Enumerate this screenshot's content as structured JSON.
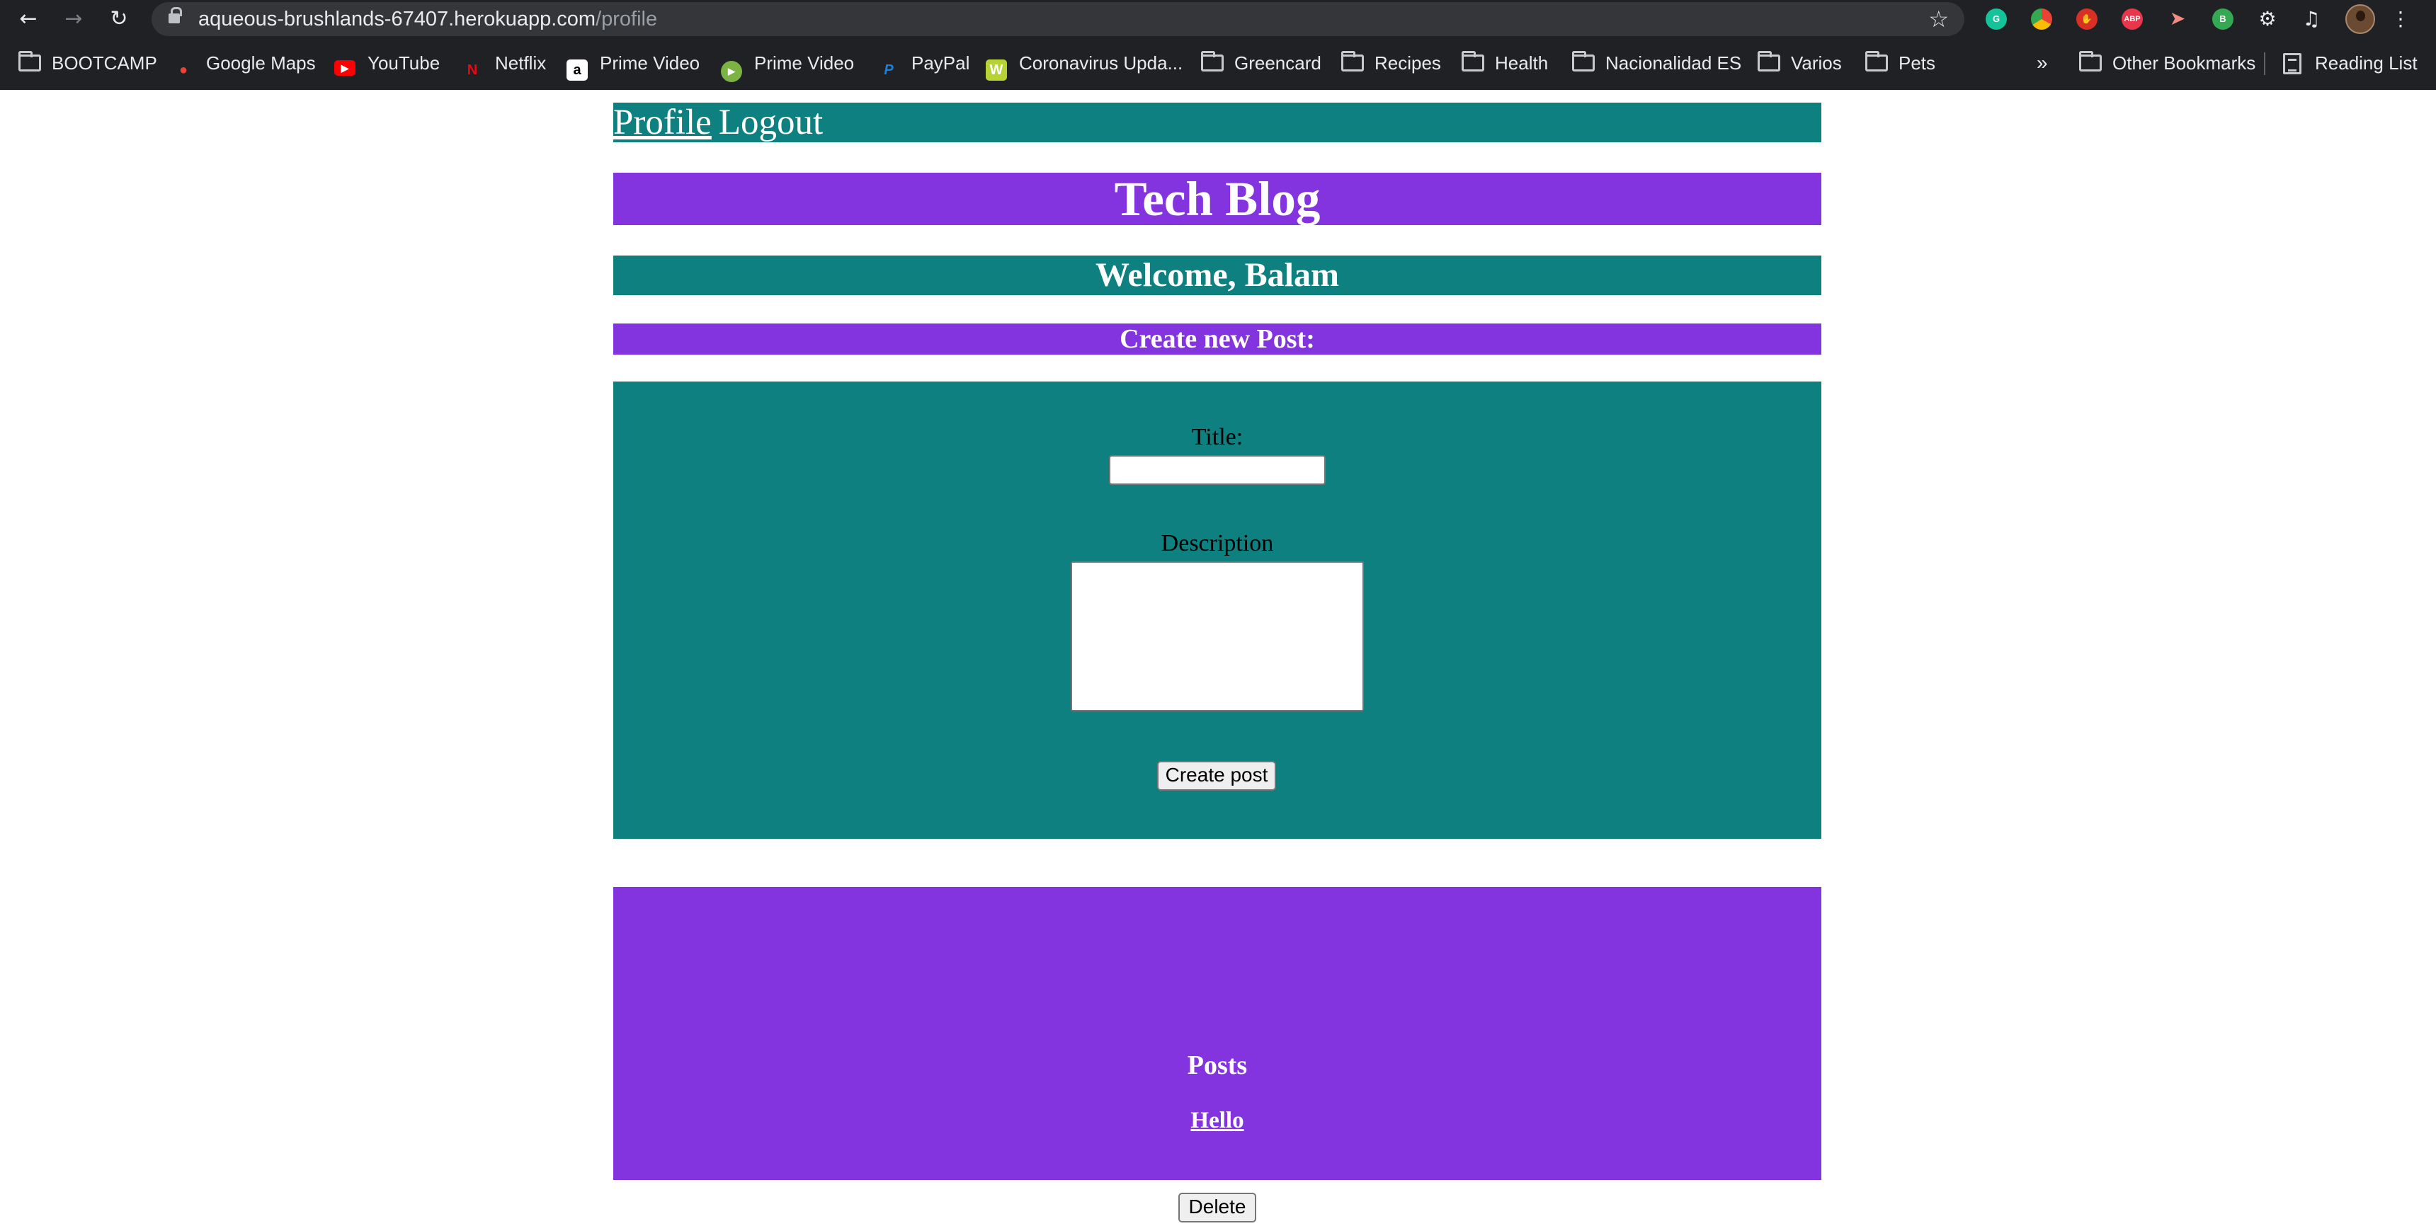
{
  "browser": {
    "url_host": "aqueous-brushlands-67407.herokuapp.com",
    "url_path": "/profile",
    "bookmarks": [
      {
        "label": "BOOTCAMP",
        "icon": "folder-icon"
      },
      {
        "label": "Google Maps",
        "icon": "google-maps-icon"
      },
      {
        "label": "YouTube",
        "icon": "youtube-icon"
      },
      {
        "label": "Netflix",
        "icon": "netflix-icon"
      },
      {
        "label": "Prime Video",
        "icon": "amazon-icon"
      },
      {
        "label": "Prime Video",
        "icon": "prime-video-icon"
      },
      {
        "label": "PayPal",
        "icon": "paypal-icon"
      },
      {
        "label": "Coronavirus Upda...",
        "icon": "coronavirus-site-icon"
      },
      {
        "label": "Greencard",
        "icon": "folder-icon"
      },
      {
        "label": "Recipes",
        "icon": "folder-icon"
      },
      {
        "label": "Health",
        "icon": "folder-icon"
      },
      {
        "label": "Nacionalidad ES",
        "icon": "folder-icon"
      },
      {
        "label": "Varios",
        "icon": "folder-icon"
      },
      {
        "label": "Pets",
        "icon": "folder-icon"
      }
    ],
    "overflow_label": "»",
    "other_bookmarks": "Other Bookmarks",
    "reading_list": "Reading List",
    "extensions": {
      "abp": "ABP",
      "b": "B"
    },
    "colors": {
      "chrome_bg": "#202124",
      "omnibox_bg": "#35363a"
    }
  },
  "nav": {
    "profile": "Profile",
    "logout": "Logout"
  },
  "site_title": "Tech Blog",
  "welcome": "Welcome, Balam",
  "create_heading": "Create new Post:",
  "form": {
    "title_label": "Title:",
    "title_value": "",
    "description_label": "Description",
    "description_value": "",
    "submit_label": "Create post"
  },
  "posts": {
    "heading": "Posts",
    "items": [
      {
        "title": "Hello",
        "delete_label": "Delete"
      }
    ]
  },
  "colors": {
    "teal": "#0e8080",
    "purple": "#8434de",
    "text_light": "#ffffff"
  }
}
